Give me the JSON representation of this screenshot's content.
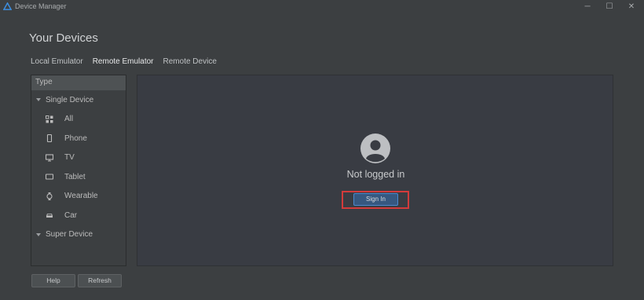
{
  "window": {
    "title": "Device Manager",
    "controls": {
      "minimize": "─",
      "maximize": "☐",
      "close": "✕"
    }
  },
  "page": {
    "heading": "Your Devices"
  },
  "tabs": [
    {
      "label": "Local Emulator",
      "active": false
    },
    {
      "label": "Remote Emulator",
      "active": true
    },
    {
      "label": "Remote Device",
      "active": false
    }
  ],
  "type_panel": {
    "header": "Type",
    "groups": [
      {
        "label": "Single Device",
        "items": [
          {
            "label": "All",
            "icon": "grid-icon"
          },
          {
            "label": "Phone",
            "icon": "phone-icon"
          },
          {
            "label": "TV",
            "icon": "tv-icon"
          },
          {
            "label": "Tablet",
            "icon": "tablet-icon"
          },
          {
            "label": "Wearable",
            "icon": "watch-icon"
          },
          {
            "label": "Car",
            "icon": "car-icon"
          }
        ]
      },
      {
        "label": "Super Device",
        "items": []
      }
    ]
  },
  "content": {
    "status": "Not logged in",
    "sign_in_label": "Sign In"
  },
  "footer": {
    "help_label": "Help",
    "refresh_label": "Refresh"
  },
  "colors": {
    "background": "#3c3f41",
    "content_background": "#393c43",
    "accent_button": "#365880",
    "highlight": "#d33b3b"
  }
}
